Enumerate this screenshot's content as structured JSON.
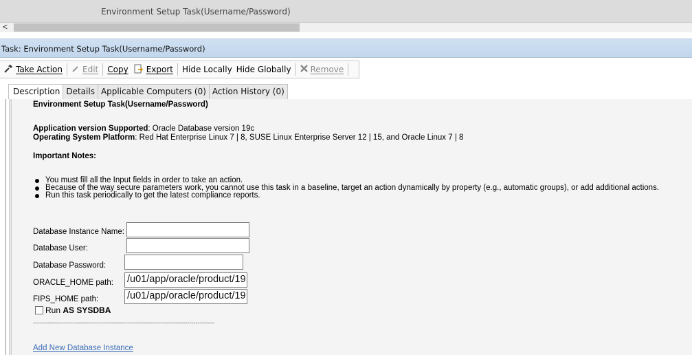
{
  "window": {
    "tab_title": "Environment Setup Task(Username/Password)",
    "scroll_left_arrow": "<"
  },
  "task_header": {
    "label": "Task: Environment Setup Task(Username/Password)"
  },
  "toolbar": {
    "take_action": "Take Action",
    "edit": "Edit",
    "copy": "Copy",
    "export": "Export",
    "hide_locally": "Hide Locally",
    "hide_globally": "Hide Globally",
    "remove": "Remove"
  },
  "tabs": [
    {
      "label": "Description",
      "active": true
    },
    {
      "label": "Details",
      "active": false
    },
    {
      "label": "Applicable Computers (0)",
      "active": false
    },
    {
      "label": "Action History (0)",
      "active": false
    }
  ],
  "description": {
    "title": "Environment Setup Task(Username/Password)",
    "app_version_label": "Application version Supported",
    "app_version_value": ": Oracle Database version 19c",
    "os_platform_label": "Operating System Platform",
    "os_platform_value": ": Red Hat Enterprise Linux 7 | 8, SUSE Linux Enterprise Server 12 | 15, and Oracle Linux 7 | 8",
    "notes_heading": "Important Notes:",
    "notes": [
      "You must fill all the Input fields in order to take an action.",
      "Because of the way secure parameters work, you cannot use this task in a baseline, target an action dynamically by property (e.g., automatic groups), or add additional actions.",
      "Run this task periodically to get the latest compliance reports."
    ]
  },
  "form": {
    "instance_name_label": "Database Instance Name:",
    "instance_name_value": "",
    "db_user_label": "Database User:",
    "db_user_value": "",
    "db_password_label": "Database Password:",
    "db_password_value": "",
    "oracle_home_label": "ORACLE_HOME path:",
    "oracle_home_value": "/u01/app/oracle/product/19",
    "fips_home_label": "FIPS_HOME path:",
    "fips_home_value": "/u01/app/oracle/product/19",
    "run_as_prefix": "Run",
    "run_as_bold": "AS SYSDBA",
    "run_as_checked": false,
    "separator": "----------------------------------------------------------------------------------------",
    "add_instance_link": "Add New Database Instance"
  }
}
